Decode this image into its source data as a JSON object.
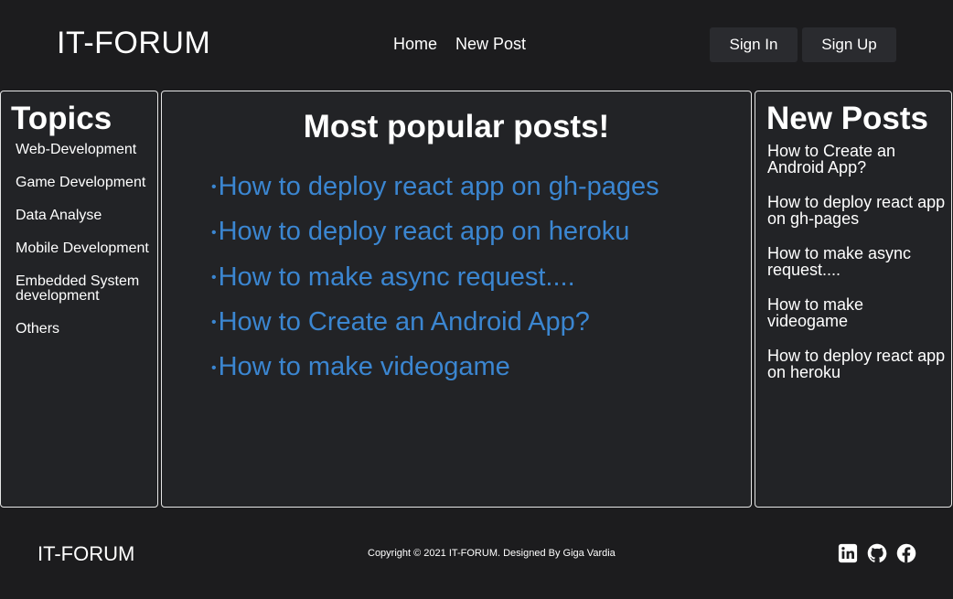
{
  "header": {
    "logo": "IT-FORUM",
    "nav": [
      "Home",
      "New Post"
    ],
    "sign_in": "Sign In",
    "sign_up": "Sign Up"
  },
  "topics": {
    "title": "Topics",
    "items": [
      "Web-Development",
      "Game Development",
      "Data Analyse",
      "Mobile Development",
      "Embedded System development",
      "Others"
    ]
  },
  "popular": {
    "title": "Most popular posts!",
    "bullet": "•",
    "items": [
      "How to deploy react app on gh-pages",
      "How to deploy react app on heroku",
      "How to make async request....",
      "How to Create an Android App?",
      "How to make videogame"
    ]
  },
  "new_posts": {
    "title": "New Posts",
    "items": [
      "How to Create an Android App?",
      "How to deploy react app on gh-pages",
      "How to make async request....",
      "How to make videogame",
      "How to deploy react app on heroku"
    ]
  },
  "footer": {
    "logo": "IT-FORUM",
    "copyright": "Copyright © 2021 IT-FORUM. Designed By Giga Vardia",
    "socials": [
      "linkedin-icon",
      "github-icon",
      "facebook-icon"
    ]
  },
  "colors": {
    "background": "#1c1c1e",
    "panel": "#222326",
    "link": "#3b86d1",
    "button": "#2a2b2f"
  }
}
